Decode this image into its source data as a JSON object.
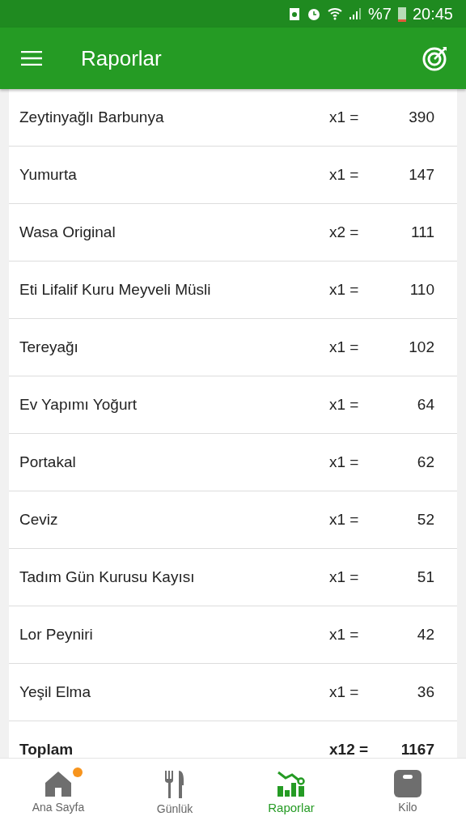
{
  "status_bar": {
    "battery_text": "%7",
    "time": "20:45"
  },
  "app_bar": {
    "title": "Raporlar"
  },
  "rows": [
    {
      "name": "Zeytinyağlı Barbunya",
      "quantity": "x1 =",
      "calories": "390"
    },
    {
      "name": "Yumurta",
      "quantity": "x1 =",
      "calories": "147"
    },
    {
      "name": "Wasa Original",
      "quantity": "x2 =",
      "calories": "111"
    },
    {
      "name": "Eti Lifalif Kuru Meyveli Müsli",
      "quantity": "x1 =",
      "calories": "110"
    },
    {
      "name": "Tereyağı",
      "quantity": "x1 =",
      "calories": "102"
    },
    {
      "name": "Ev Yapımı Yoğurt",
      "quantity": "x1 =",
      "calories": "64"
    },
    {
      "name": "Portakal",
      "quantity": "x1 =",
      "calories": "62"
    },
    {
      "name": "Ceviz",
      "quantity": "x1 =",
      "calories": "52"
    },
    {
      "name": "Tadım Gün Kurusu Kayısı",
      "quantity": "x1 =",
      "calories": "51"
    },
    {
      "name": "Lor Peyniri",
      "quantity": "x1 =",
      "calories": "42"
    },
    {
      "name": "Yeşil Elma",
      "quantity": "x1 =",
      "calories": "36"
    }
  ],
  "total": {
    "name": "Toplam",
    "quantity": "x12 =",
    "calories": "1167"
  },
  "bottom_nav": [
    {
      "kind": "home",
      "label": "Ana Sayfa",
      "selected": false,
      "badge": true
    },
    {
      "kind": "diary",
      "label": "Günlük",
      "selected": false,
      "badge": false
    },
    {
      "kind": "reports",
      "label": "Raporlar",
      "selected": true,
      "badge": false
    },
    {
      "kind": "weight",
      "label": "Kilo",
      "selected": false,
      "badge": false
    }
  ]
}
